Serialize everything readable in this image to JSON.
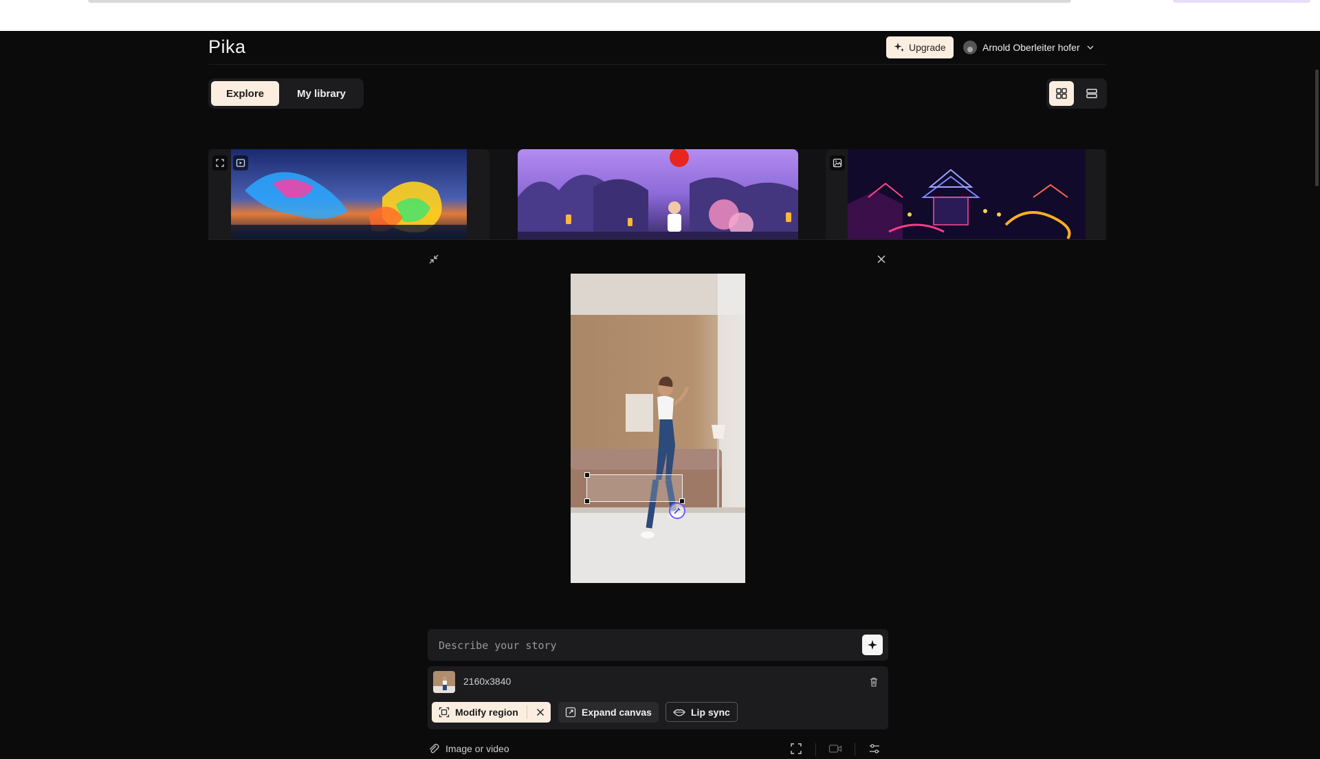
{
  "app": {
    "logo": "Pika"
  },
  "header": {
    "upgrade_label": "Upgrade",
    "user_name": "Arnold Oberleiter hofer"
  },
  "tabs": [
    {
      "label": "Explore",
      "active": true
    },
    {
      "label": "My library",
      "active": false
    }
  ],
  "view_toggle": {
    "grid_icon": "grid-icon",
    "list_icon": "list-icon",
    "active": "grid"
  },
  "gallery": {
    "cards": [
      {
        "subject": "neon dragon over ocean at sunset",
        "icons": [
          "expand-icon",
          "video-icon"
        ]
      },
      {
        "subject": "animated boy with lanterns and cherry blossoms",
        "icons": []
      },
      {
        "subject": "neon pagoda city with dragon",
        "icons": [
          "image-icon"
        ]
      }
    ]
  },
  "editor": {
    "prompt_placeholder": "Describe your story",
    "asset_resolution": "2160x3840",
    "actions": {
      "modify_region": "Modify region",
      "expand_canvas": "Expand canvas",
      "lip_sync": "Lip sync"
    },
    "attach_label": "Image or video"
  },
  "colors": {
    "background": "#0b0b0c",
    "accent": "#fbeee0",
    "panel": "#1c1c1f",
    "brush": "#6c5cff"
  }
}
